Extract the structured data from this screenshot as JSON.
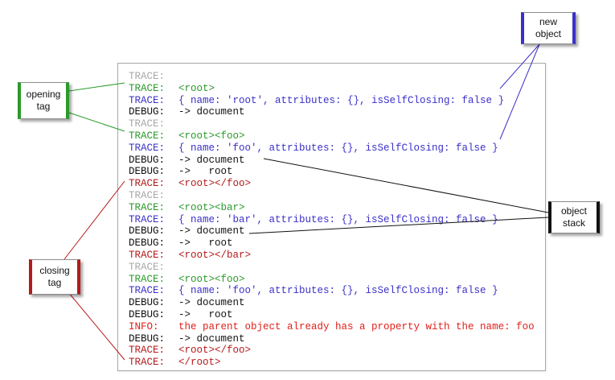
{
  "log_lines": [
    {
      "level": "TRACE:",
      "message": "",
      "color": "#a8a8a8"
    },
    {
      "level": "TRACE:",
      "message": "<root>",
      "color": "#2a9a2a"
    },
    {
      "level": "TRACE:",
      "message": "{ name: 'root', attributes: {}, isSelfClosing: false }",
      "color": "#3b30c8"
    },
    {
      "level": "DEBUG:",
      "message": "-> document",
      "color": "#111111"
    },
    {
      "level": "TRACE:",
      "message": "",
      "color": "#a8a8a8"
    },
    {
      "level": "TRACE:",
      "message": "<root><foo>",
      "color": "#2a9a2a"
    },
    {
      "level": "TRACE:",
      "message": "{ name: 'foo', attributes: {}, isSelfClosing: false }",
      "color": "#3b30c8"
    },
    {
      "level": "DEBUG:",
      "message": "-> document",
      "color": "#111111"
    },
    {
      "level": "DEBUG:",
      "message": "->   root",
      "color": "#111111"
    },
    {
      "level": "TRACE:",
      "message": "<root></foo>",
      "color": "#b51a1a"
    },
    {
      "level": "TRACE:",
      "message": "",
      "color": "#a8a8a8"
    },
    {
      "level": "TRACE:",
      "message": "<root><bar>",
      "color": "#2a9a2a"
    },
    {
      "level": "TRACE:",
      "message": "{ name: 'bar', attributes: {}, isSelfClosing: false }",
      "color": "#3b30c8"
    },
    {
      "level": "DEBUG:",
      "message": "-> document",
      "color": "#111111"
    },
    {
      "level": "DEBUG:",
      "message": "->   root",
      "color": "#111111"
    },
    {
      "level": "TRACE:",
      "message": "<root></bar>",
      "color": "#b51a1a"
    },
    {
      "level": "TRACE:",
      "message": "",
      "color": "#a8a8a8"
    },
    {
      "level": "TRACE:",
      "message": "<root><foo>",
      "color": "#2a9a2a"
    },
    {
      "level": "TRACE:",
      "message": "{ name: 'foo', attributes: {}, isSelfClosing: false }",
      "color": "#3b30c8"
    },
    {
      "level": "DEBUG:",
      "message": "-> document",
      "color": "#111111"
    },
    {
      "level": "DEBUG:",
      "message": "->   root",
      "color": "#111111"
    },
    {
      "level": "INFO:",
      "message": "the parent object already has a property with the name: foo",
      "color": "#e0201a"
    },
    {
      "level": "DEBUG:",
      "message": "-> document",
      "color": "#111111"
    },
    {
      "level": "TRACE:",
      "message": "<root></foo>",
      "color": "#b51a1a"
    },
    {
      "level": "TRACE:",
      "message": "</root>",
      "color": "#b51a1a"
    }
  ],
  "callouts": {
    "opening_tag": {
      "text": "opening\ntag",
      "color": "#2a9a2a"
    },
    "new_object": {
      "text": "new\nobject",
      "color": "#3b30c8"
    },
    "object_stack": {
      "text": "object\nstack",
      "color": "#111111"
    },
    "closing_tag": {
      "text": "closing\ntag",
      "color": "#b51a1a"
    }
  }
}
